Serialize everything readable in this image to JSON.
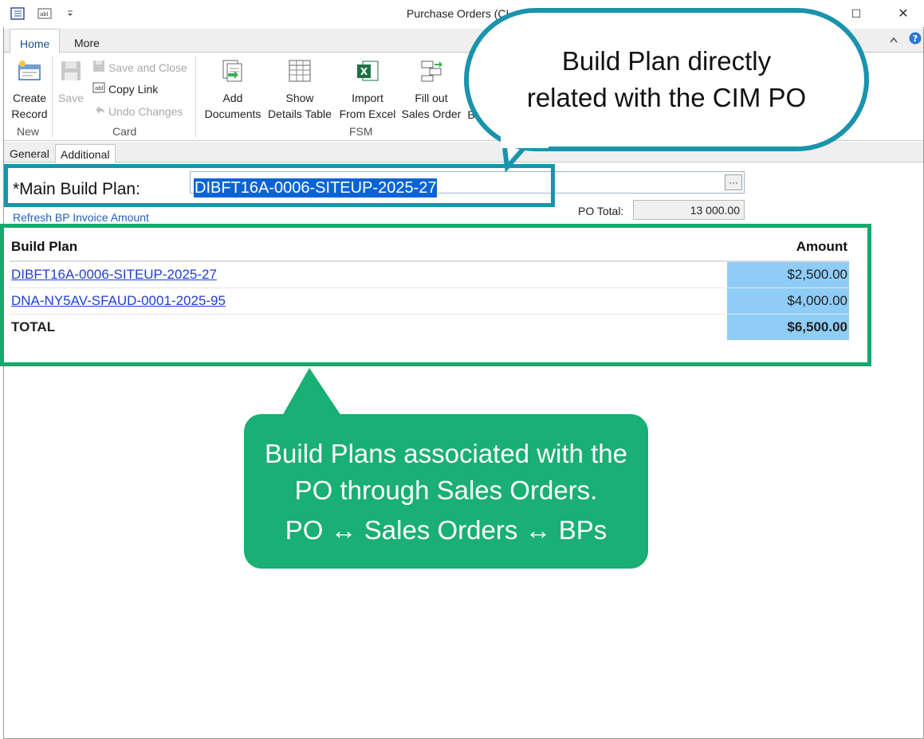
{
  "window": {
    "title": "Purchase Orders (CI",
    "minimize": "—",
    "maximize": "☐",
    "close": "✕",
    "quick_access_icons": [
      "form-icon",
      "text-field-icon",
      "dropdown-arrow-icon"
    ]
  },
  "ribbon_tabs": [
    {
      "label": "Home",
      "active": true
    },
    {
      "label": "More",
      "active": false
    }
  ],
  "ribbon": {
    "create_record": {
      "line1": "Create",
      "line2": "Record"
    },
    "save": {
      "label": "Save"
    },
    "save_and_close": "Save and Close",
    "copy_link": "Copy Link",
    "undo_changes": "Undo Changes",
    "add_documents": {
      "line1": "Add",
      "line2": "Documents"
    },
    "show_details_table": {
      "line1": "Show",
      "line2": "Details Table"
    },
    "import_from_excel": {
      "line1": "Import",
      "line2": "From Excel"
    },
    "fill_out_sales_order": {
      "line1": "Fill out",
      "line2": "Sales Order"
    },
    "partial_next": "B",
    "groups": {
      "new": "New",
      "card": "Card",
      "fsm": "FSM"
    }
  },
  "sub_tabs": [
    {
      "label": "General",
      "active": false
    },
    {
      "label": "Additional",
      "active": true
    }
  ],
  "form": {
    "main_build_plan_label": "*Main Build Plan:",
    "main_build_plan_value": "DIBFT16A-0006-SITEUP-2025-27",
    "ellipsis": "···",
    "refresh_link": "Refresh BP Invoice Amount",
    "po_total_label": "PO Total:",
    "po_total_value": "13 000.00"
  },
  "table": {
    "headers": {
      "build_plan": "Build Plan",
      "amount": "Amount"
    },
    "rows": [
      {
        "build_plan": "DIBFT16A-0006-SITEUP-2025-27",
        "amount": "$2,500.00"
      },
      {
        "build_plan": "DNA-NY5AV-SFAUD-0001-2025-95",
        "amount": "$4,000.00"
      }
    ],
    "total": {
      "label": "TOTAL",
      "amount": "$6,500.00"
    }
  },
  "callouts": {
    "blue": {
      "line1": "Build Plan directly",
      "line2": "related with the CIM PO"
    },
    "green": {
      "line1": "Build Plans associated with the",
      "line2": "PO through Sales Orders.",
      "line3": "PO ↔ Sales Orders ↔ BPs"
    }
  },
  "colors": {
    "callout_blue": "#1a93ad",
    "callout_green": "#1aaf74",
    "amount_cell": "#8fcdf7",
    "selection": "#0a63d6"
  }
}
